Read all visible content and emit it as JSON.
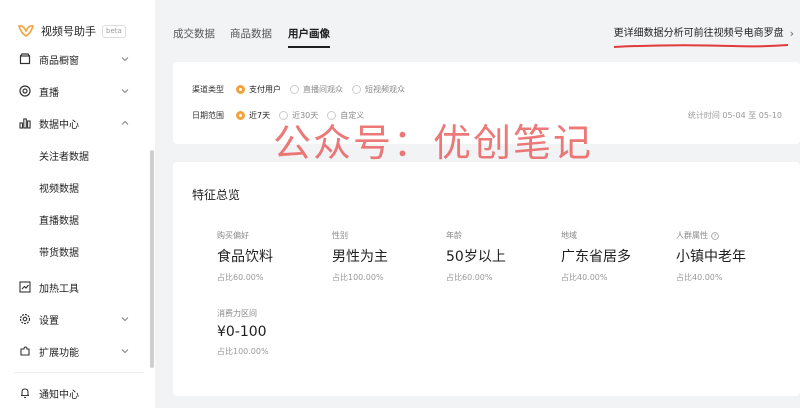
{
  "brand": {
    "name": "视频号助手",
    "tag": "beta"
  },
  "sidebar": {
    "items": [
      {
        "label": "商品橱窗",
        "icon": "shop-icon"
      },
      {
        "label": "直播",
        "icon": "live-icon"
      },
      {
        "label": "数据中心",
        "icon": "chart-icon"
      },
      {
        "label": "加热工具",
        "icon": "trend-icon"
      },
      {
        "label": "设置",
        "icon": "gear-icon"
      },
      {
        "label": "扩展功能",
        "icon": "puzzle-icon"
      },
      {
        "label": "通知中心",
        "icon": "bell-icon"
      }
    ],
    "sub_items": [
      {
        "label": "关注者数据"
      },
      {
        "label": "视频数据"
      },
      {
        "label": "直播数据"
      },
      {
        "label": "带货数据"
      }
    ]
  },
  "tabs": [
    {
      "label": "成交数据"
    },
    {
      "label": "商品数据"
    },
    {
      "label": "用户画像"
    }
  ],
  "top_link": "更详细数据分析可前往视频号电商罗盘",
  "filters": {
    "channel": {
      "label": "渠道类型",
      "options": [
        "支付用户",
        "直播间观众",
        "短视频观众"
      ],
      "selected": "支付用户"
    },
    "date": {
      "label": "日期范围",
      "options": [
        "近7天",
        "近30天",
        "自定义"
      ],
      "selected": "近7天"
    },
    "stat_time": "统计时间 05-04 至 05-10"
  },
  "watermark": "公众号：优创笔记",
  "features": {
    "title": "特征总览",
    "items": [
      {
        "label": "购买偏好",
        "value": "食品饮料",
        "ratio": "占比60.00%"
      },
      {
        "label": "性别",
        "value": "男性为主",
        "ratio": "占比100.00%"
      },
      {
        "label": "年龄",
        "value": "50岁以上",
        "ratio": "占比60.00%"
      },
      {
        "label": "地域",
        "value": "广东省居多",
        "ratio": "占比40.00%"
      },
      {
        "label": "人群属性",
        "value": "小镇中老年",
        "ratio": "占比40.00%"
      },
      {
        "label": "消费力区间",
        "value": "¥0-100",
        "ratio": "占比100.00%"
      }
    ]
  },
  "colors": {
    "accent": "#f0a33c",
    "watermark": "#e95a5a"
  }
}
